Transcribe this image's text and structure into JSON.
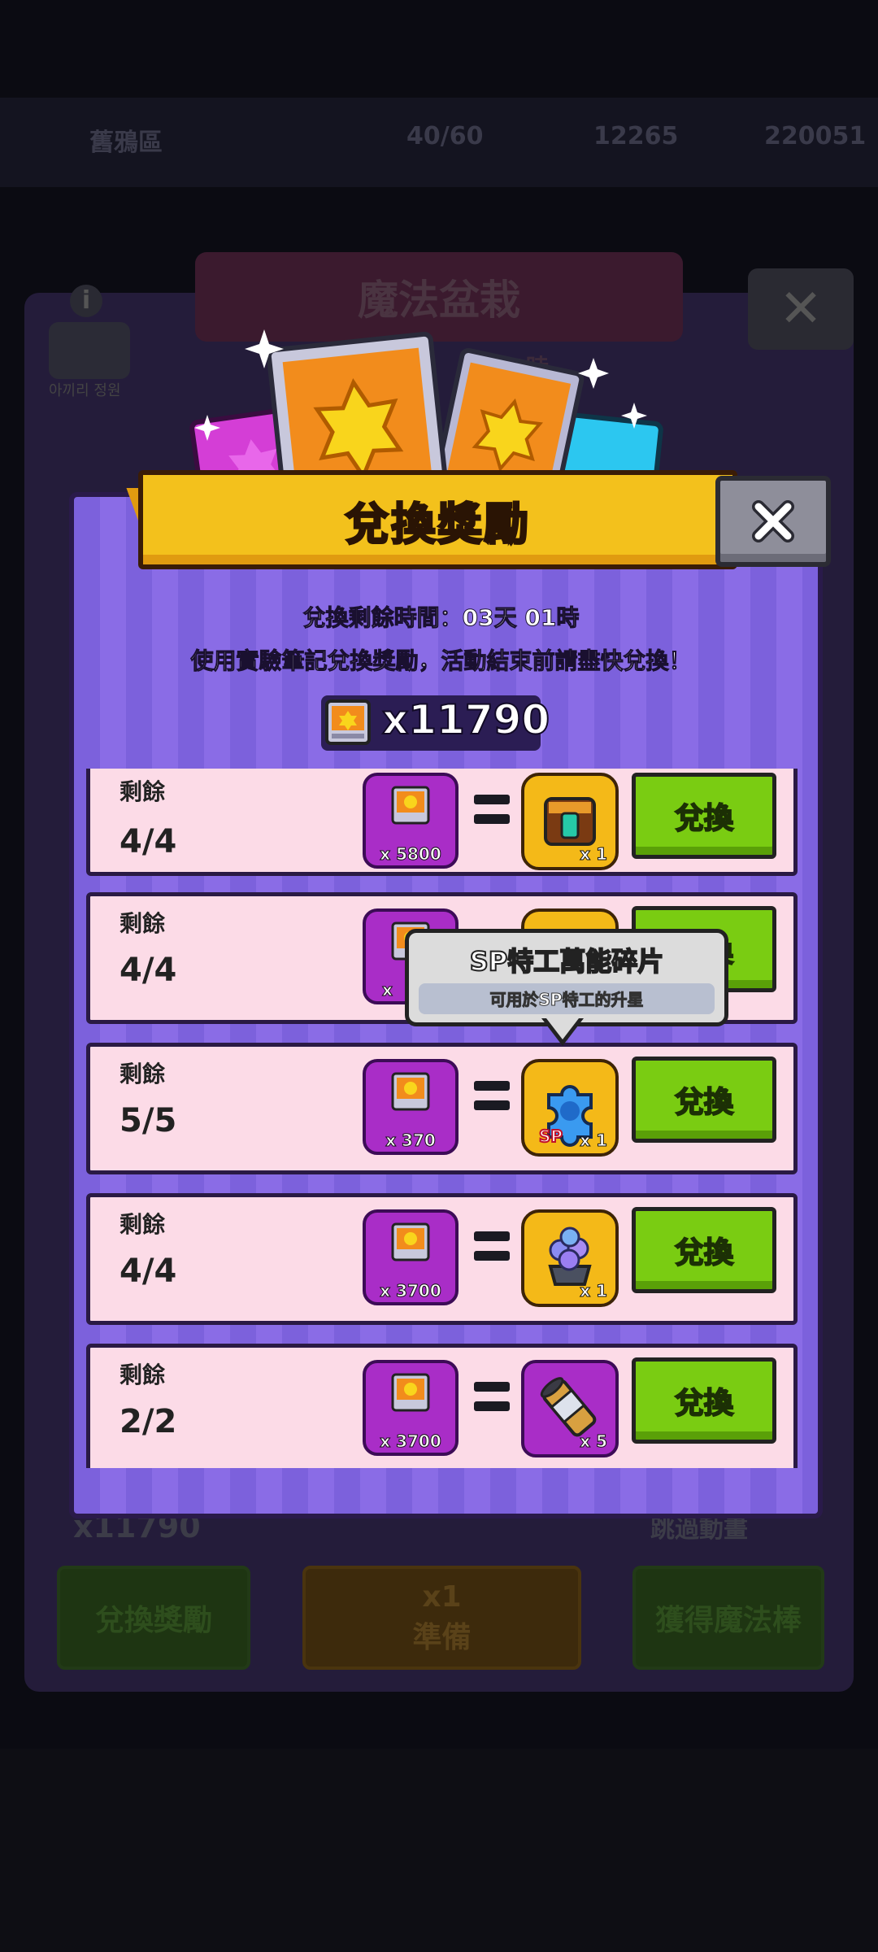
{
  "background": {
    "top_name": "舊鴉區",
    "stat_1": "40/60",
    "stat_2": "12265",
    "stat_3": "220051",
    "panel_title": "魔法盆栽",
    "avatar_label": "아끼리 정원",
    "countdown_fragment": "天 01時",
    "notebook_count": "x11790",
    "skip_animation": "跳過動畫",
    "exchange_rewards_btn": "兌換獎勵",
    "ready_btn": "準備",
    "ready_btn_count": "x1",
    "get_wand_btn": "獲得魔法棒"
  },
  "modal": {
    "title": "兌換獎勵",
    "remaining_time_label": "兌換剩餘時間：03天 01時",
    "instruction": "使用實驗筆記兌換獎勵，活動結束前請盡快兌換！",
    "balance": "x11790"
  },
  "rows": [
    {
      "remaining_label": "剩餘",
      "remaining": "4/4",
      "cost": "x 5800",
      "reward_icon": "treasure-chest-icon",
      "reward_qty": "x 1",
      "button": "兌換"
    },
    {
      "remaining_label": "剩餘",
      "remaining": "4/4",
      "cost": "x",
      "reward_icon": "reward-icon",
      "reward_qty": "",
      "button": "兌換"
    },
    {
      "remaining_label": "剩餘",
      "remaining": "5/5",
      "cost": "x 370",
      "reward_icon": "sp-puzzle-piece-icon",
      "reward_qty": "x 1",
      "button": "兌換"
    },
    {
      "remaining_label": "剩餘",
      "remaining": "4/4",
      "cost": "x 3700",
      "reward_icon": "crystal-pot-icon",
      "reward_qty": "x 1",
      "button": "兌換"
    },
    {
      "remaining_label": "剩餘",
      "remaining": "2/2",
      "cost": "x 3700",
      "reward_icon": "cylinder-capsule-icon",
      "reward_qty": "x 5",
      "button": "兌換"
    }
  ],
  "tooltip": {
    "title": "SP特工萬能碎片",
    "description": "可用於SP特工的升星"
  },
  "colors": {
    "modal_purple": "#8a6ce6",
    "ribbon_yellow": "#f3c11c",
    "row_pink": "#fcdbe7",
    "button_green": "#7acc12",
    "reward_gold": "#f4b918",
    "cost_purple": "#a92dc7"
  }
}
